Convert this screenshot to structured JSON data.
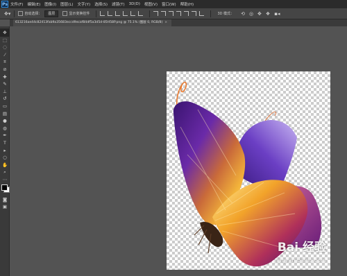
{
  "app": {
    "logo": "Ps"
  },
  "menu": [
    "文件(F)",
    "编辑(E)",
    "图像(I)",
    "图层(L)",
    "文字(Y)",
    "选择(S)",
    "滤镜(T)",
    "3D(D)",
    "视图(V)",
    "窗口(W)",
    "帮助(H)"
  ],
  "options": {
    "auto_select_label": "自动选择：",
    "auto_select_value": "图层",
    "show_transform_label": "显示变换控件",
    "mode_label": "3D 模式："
  },
  "document_tab": {
    "title": "613216ae44c82413fab9a35683eccd9ecaf84df5a3d5d-85H58P.png @ 75.1% (图层 0, RGB/8)",
    "close": "×"
  },
  "tools": [
    {
      "icon": "move-icon",
      "glyph": "✥"
    },
    {
      "icon": "marquee-icon",
      "glyph": "⬚"
    },
    {
      "icon": "lasso-icon",
      "glyph": "◌"
    },
    {
      "icon": "quick-select-icon",
      "glyph": "⁄"
    },
    {
      "icon": "crop-icon",
      "glyph": "⌗"
    },
    {
      "icon": "eyedropper-icon",
      "glyph": "⊘"
    },
    {
      "icon": "healing-brush-icon",
      "glyph": "✚"
    },
    {
      "icon": "brush-icon",
      "glyph": "✎"
    },
    {
      "icon": "clone-stamp-icon",
      "glyph": "⊥"
    },
    {
      "icon": "history-brush-icon",
      "glyph": "↺"
    },
    {
      "icon": "eraser-icon",
      "glyph": "▭"
    },
    {
      "icon": "gradient-icon",
      "glyph": "▤"
    },
    {
      "icon": "blur-icon",
      "glyph": "●"
    },
    {
      "icon": "dodge-icon",
      "glyph": "◍"
    },
    {
      "icon": "pen-icon",
      "glyph": "✒"
    },
    {
      "icon": "type-icon",
      "glyph": "T"
    },
    {
      "icon": "path-select-icon",
      "glyph": "▸"
    },
    {
      "icon": "shape-icon",
      "glyph": "○"
    },
    {
      "icon": "hand-icon",
      "glyph": "✋"
    },
    {
      "icon": "zoom-icon",
      "glyph": "⌕"
    },
    {
      "icon": "more-tools-icon",
      "glyph": "⋯"
    }
  ],
  "bottom_tools": [
    {
      "icon": "quick-mask-icon",
      "glyph": "◙"
    },
    {
      "icon": "screen-mode-icon",
      "glyph": "▣"
    }
  ],
  "watermark": {
    "text": "Bai 经验",
    "sub": "jingyan.baidu.com"
  },
  "colors": {
    "menubar": "#2b2b2b",
    "workspace": "#535353",
    "wing_purple": "#4a1c8a",
    "wing_orange": "#f0a020",
    "wing_yellow": "#ffe68a"
  }
}
